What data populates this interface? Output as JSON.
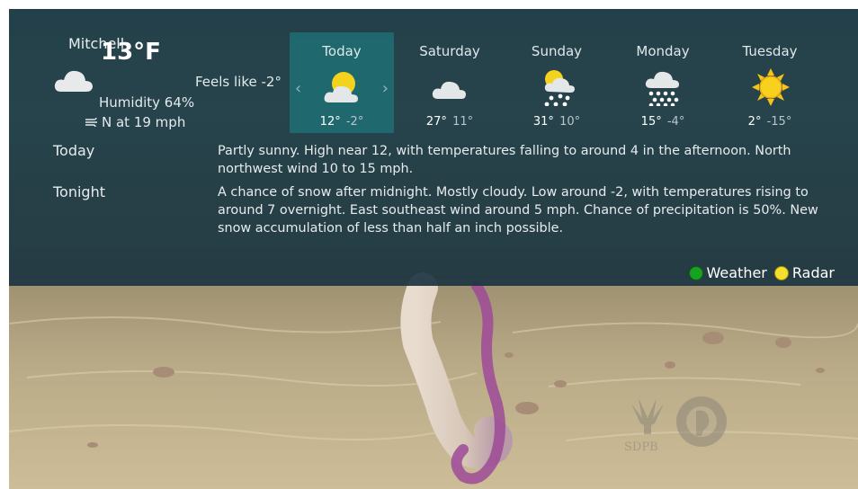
{
  "current": {
    "city": "Mitchell",
    "temperature": "13°F",
    "feels_like": "Feels like -2°",
    "humidity": "Humidity 64%",
    "wind": "N at 19 mph",
    "icon": "cloud-icon"
  },
  "forecast_days": [
    {
      "name": "Today",
      "high": "12°",
      "low": "-2°",
      "icon": "partly-sunny-icon",
      "selected": true
    },
    {
      "name": "Saturday",
      "high": "27°",
      "low": "11°",
      "icon": "cloud-icon"
    },
    {
      "name": "Sunday",
      "high": "31°",
      "low": "10°",
      "icon": "sun-snow-icon"
    },
    {
      "name": "Monday",
      "high": "15°",
      "low": "-4°",
      "icon": "snow-icon"
    },
    {
      "name": "Tuesday",
      "high": "2°",
      "low": "-15°",
      "icon": "sun-icon"
    }
  ],
  "details": [
    {
      "label": "Today",
      "text": "Partly sunny. High near 12, with temperatures falling to around 4 in the afternoon. North northwest wind 10 to 15 mph."
    },
    {
      "label": "Tonight",
      "text": "A chance of snow after midnight. Mostly cloudy. Low around -2, with temperatures rising to around 7 overnight. East southeast wind around 5 mph. Chance of precipitation is 50%. New snow accumulation of less than half an inch possible."
    }
  ],
  "legend": {
    "weather_label": "Weather",
    "radar_label": "Radar",
    "weather_color": "#17a21f",
    "radar_color": "#f5df2a"
  },
  "navigation": {
    "prev_arrow": "‹",
    "next_arrow": "›"
  },
  "logo": {
    "text": "SDPB"
  }
}
